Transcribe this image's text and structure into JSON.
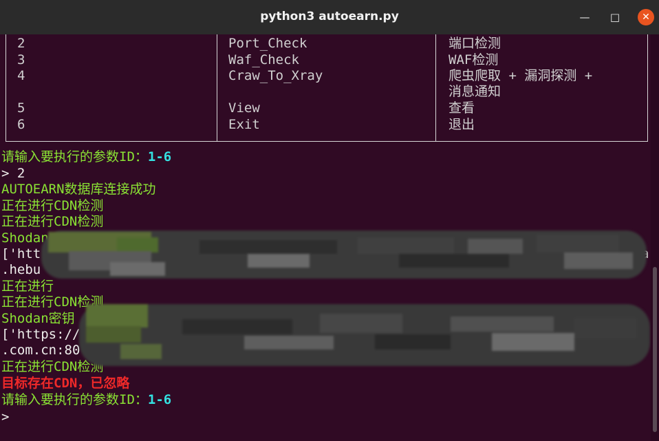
{
  "window": {
    "title": "python3 autoearn.py",
    "minimize_glyph": "—",
    "maximize_glyph": "□",
    "close_glyph": "✕",
    "close_color": "#e95420"
  },
  "menu_table": {
    "rows": [
      {
        "id": "2",
        "name": "Port_Check",
        "desc": "端口检测"
      },
      {
        "id": "3",
        "name": "Waf_Check",
        "desc": "WAF检测"
      },
      {
        "id": "4",
        "name": "Craw_To_Xray",
        "desc": "爬虫爬取 + 漏洞探测 +",
        "desc2": "消息通知"
      },
      {
        "id": "5",
        "name": "View",
        "desc": "查看"
      },
      {
        "id": "6",
        "name": "Exit",
        "desc": "退出"
      }
    ]
  },
  "terminal": {
    "prompt_text_1": "请输入要执行的参数ID：",
    "range_1": "1-6",
    "input_1": "> 2",
    "db_ok": "AUTOEARN数据库连接成功",
    "cdn_check_1": "正在进行CDN检测",
    "cdn_check_2": "正在进行CDN检测",
    "shodan_1": "Shodan",
    "list_1": "['htt",
    "list_1_tail": "a",
    "domain_1": ".hebu",
    "cdn_check_3": "正在进行",
    "cdn_check_4": "正在进行CDN检测",
    "shodan_2": "Shodan密钥",
    "list_2": "['https://",
    "domain_2": ".com.cn:80",
    "cdn_check_5": "正在进行CDN检测",
    "cdn_ignored": "目标存在CDN，已忽略",
    "prompt_text_2": "请输入要执行的参数ID：",
    "range_2": "1-6",
    "input_2": ">"
  },
  "colors": {
    "background": "#300a24",
    "green": "#8ae234",
    "red": "#ef2929",
    "cyan": "#34e2e2"
  }
}
